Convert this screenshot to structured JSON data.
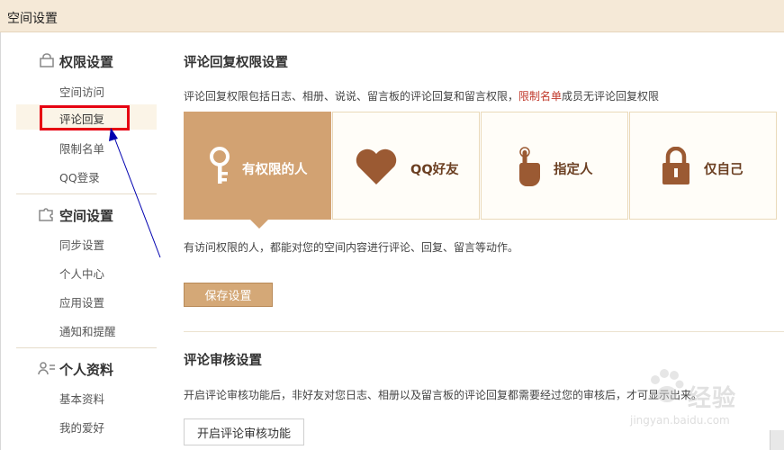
{
  "window": {
    "title": "空间设置"
  },
  "sidebar": {
    "sections": [
      {
        "label": "权限设置",
        "icon": "lock-icon",
        "items": [
          "空间访问",
          "评论回复",
          "限制名单",
          "QQ登录"
        ]
      },
      {
        "label": "空间设置",
        "icon": "puzzle-icon",
        "items": [
          "同步设置",
          "个人中心",
          "应用设置",
          "通知和提醒"
        ]
      },
      {
        "label": "个人资料",
        "icon": "user-card-icon",
        "items": [
          "基本资料",
          "我的爱好"
        ]
      }
    ],
    "active_item": "评论回复"
  },
  "comment_permission": {
    "title": "评论回复权限设置",
    "desc_prefix": "评论回复权限包括日志、相册、说说、留言板的评论回复和留言权限，",
    "desc_link": "限制名单",
    "desc_suffix": "成员无评论回复权限",
    "options": [
      {
        "label": "有权限的人",
        "icon": "key-icon",
        "selected": true
      },
      {
        "label": "QQ好友",
        "icon": "heart-icon",
        "selected": false
      },
      {
        "label": "指定人",
        "icon": "hand-pointer-icon",
        "selected": false
      },
      {
        "label": "仅自己",
        "icon": "padlock-icon",
        "selected": false
      }
    ],
    "hint": "有访问权限的人，都能对您的空间内容进行评论、回复、留言等动作。",
    "save_label": "保存设置"
  },
  "comment_review": {
    "title": "评论审核设置",
    "desc": "开启评论审核功能后，非好友对您日志、相册以及留言板的评论回复都需要经过您的审核后，才可显示出来。",
    "button_label": "开启评论审核功能"
  },
  "watermark": {
    "brand": "经验",
    "url": "jingyan.baidu.com"
  },
  "colors": {
    "accent": "#d2a272",
    "highlight": "#e60012",
    "annotation_arrow": "#0000b0"
  }
}
